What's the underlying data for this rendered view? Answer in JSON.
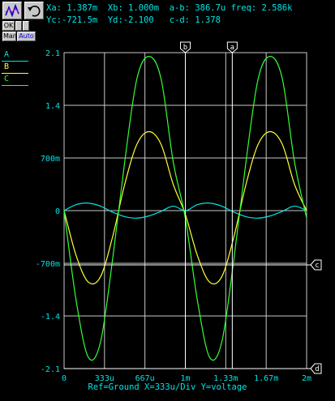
{
  "toolbar": {
    "waveform_icon": "waveform-icon",
    "undo_icon": "undo-icon",
    "ok_label": "OK",
    "man_label": "Man",
    "auto_label": "Auto"
  },
  "readout": {
    "line1": "Xa: 1.387m  Xb: 1.000m  a-b: 386.7u freq: 2.586k",
    "line2": "Yc:-721.5m  Yd:-2.100   c-d: 1.378"
  },
  "legend": [
    {
      "label": "A",
      "color": "#00e5e5"
    },
    {
      "label": "B",
      "color": "#ffff33"
    },
    {
      "label": "C",
      "color": "#33ff33"
    }
  ],
  "cursors": {
    "a": {
      "label": "a",
      "x": 0.001387
    },
    "b": {
      "label": "b",
      "x": 0.001
    },
    "c": {
      "label": "c",
      "y": -0.7215
    },
    "d": {
      "label": "d",
      "y": -2.1
    }
  },
  "footer": "Ref=Ground  X=333u/Div Y=voltage",
  "colors": {
    "grid": "#c8c8c8",
    "text": "#00e5e5",
    "background": "#000000",
    "cursor": "#ffffff"
  },
  "chart_data": {
    "type": "line",
    "xlim": [
      0,
      0.002
    ],
    "ylim": [
      -2.1,
      2.1
    ],
    "x_ticks": [
      "0",
      "333u",
      "667u",
      "1m",
      "1.33m",
      "1.67m",
      "2m"
    ],
    "y_ticks": [
      "2.1",
      "1.4",
      "700m",
      "0",
      "-700m",
      "-1.4",
      "-2.1"
    ],
    "grid": true,
    "series": [
      {
        "name": "A",
        "color": "#00e5e5",
        "x": [
          0,
          0.0001,
          0.0002,
          0.0003,
          0.0004,
          0.0005,
          0.0006,
          0.0007,
          0.0008,
          0.0009,
          0.001,
          0.0011,
          0.0012,
          0.0013,
          0.0014,
          0.0015,
          0.0016,
          0.0017,
          0.0018,
          0.0019,
          0.002
        ],
        "y": [
          0,
          0.08,
          0.1,
          0.06,
          -0.02,
          -0.08,
          -0.1,
          -0.07,
          -0.01,
          0.06,
          0,
          0.08,
          0.1,
          0.06,
          -0.02,
          -0.08,
          -0.1,
          -0.07,
          -0.01,
          0.06,
          0
        ]
      },
      {
        "name": "B",
        "color": "#ffff33",
        "x": [
          0,
          0.0001,
          0.0002,
          0.0003,
          0.0004,
          0.0005,
          0.0006,
          0.0007,
          0.0008,
          0.0009,
          0.001,
          0.0011,
          0.0012,
          0.0013,
          0.0014,
          0.0015,
          0.0016,
          0.0017,
          0.0018,
          0.0019,
          0.002
        ],
        "y": [
          0,
          -0.6,
          -0.95,
          -0.88,
          -0.35,
          0.35,
          0.88,
          1.05,
          0.88,
          0.35,
          -0.05,
          -0.6,
          -0.95,
          -0.88,
          -0.35,
          0.35,
          0.88,
          1.05,
          0.88,
          0.35,
          0
        ]
      },
      {
        "name": "C",
        "color": "#33ff33",
        "x": [
          0,
          0.0001,
          0.0002,
          0.0003,
          0.0004,
          0.0005,
          0.0006,
          0.0007,
          0.0008,
          0.0009,
          0.001,
          0.0011,
          0.0012,
          0.0013,
          0.0014,
          0.0015,
          0.0016,
          0.0017,
          0.0018,
          0.0019,
          0.002
        ],
        "y": [
          0,
          -1.2,
          -1.95,
          -1.75,
          -0.65,
          0.65,
          1.75,
          2.05,
          1.75,
          0.65,
          -0.1,
          -1.2,
          -1.95,
          -1.75,
          -0.65,
          0.65,
          1.75,
          2.05,
          1.75,
          0.65,
          -0.1
        ]
      }
    ]
  }
}
